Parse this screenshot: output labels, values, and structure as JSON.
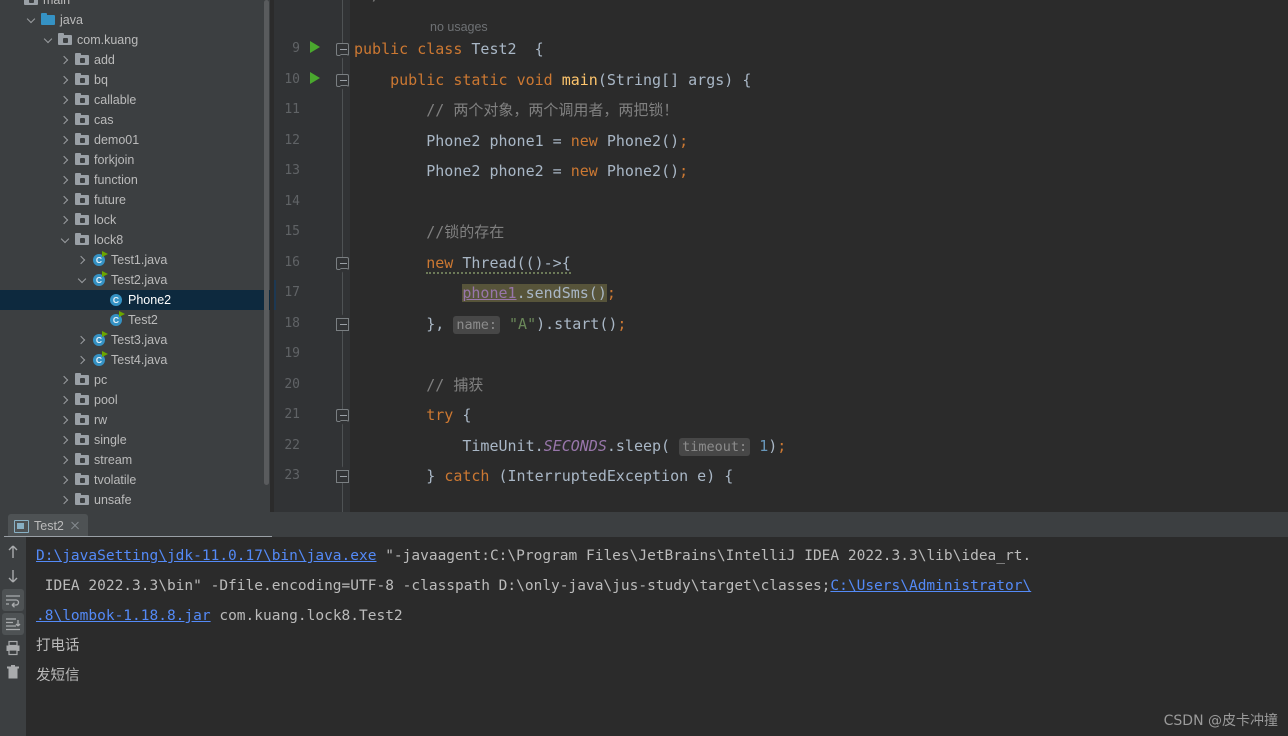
{
  "ide": {
    "theme_bg": "#2b2b2b",
    "panel_bg": "#3c3f41",
    "accent_blue": "#3592c4",
    "selection_blue": "#0d293e",
    "link_blue": "#548af7",
    "keyword_orange": "#cc7832",
    "string_green": "#6a8759",
    "field_purple": "#9876aa",
    "number_blue": "#6897bb",
    "comment_grey": "#808080",
    "run_green": "#4aa82e"
  },
  "project_tree": {
    "name": "project-tree",
    "rows": [
      {
        "label": "main",
        "indent": 0,
        "arrow": "none",
        "icon": "folder-package-icon",
        "partial": true
      },
      {
        "label": "java",
        "indent": 1,
        "arrow": "down",
        "icon": "source-root-folder-icon"
      },
      {
        "label": "com.kuang",
        "indent": 2,
        "arrow": "down",
        "icon": "folder-package-icon"
      },
      {
        "label": "add",
        "indent": 3,
        "arrow": "right",
        "icon": "folder-package-icon"
      },
      {
        "label": "bq",
        "indent": 3,
        "arrow": "right",
        "icon": "folder-package-icon"
      },
      {
        "label": "callable",
        "indent": 3,
        "arrow": "right",
        "icon": "folder-package-icon"
      },
      {
        "label": "cas",
        "indent": 3,
        "arrow": "right",
        "icon": "folder-package-icon"
      },
      {
        "label": "demo01",
        "indent": 3,
        "arrow": "right",
        "icon": "folder-package-icon"
      },
      {
        "label": "forkjoin",
        "indent": 3,
        "arrow": "right",
        "icon": "folder-package-icon"
      },
      {
        "label": "function",
        "indent": 3,
        "arrow": "right",
        "icon": "folder-package-icon"
      },
      {
        "label": "future",
        "indent": 3,
        "arrow": "right",
        "icon": "folder-package-icon"
      },
      {
        "label": "lock",
        "indent": 3,
        "arrow": "right",
        "icon": "folder-package-icon"
      },
      {
        "label": "lock8",
        "indent": 3,
        "arrow": "down",
        "icon": "folder-package-icon"
      },
      {
        "label": "Test1.java",
        "indent": 4,
        "arrow": "right",
        "icon": "java-class-runnable-icon"
      },
      {
        "label": "Test2.java",
        "indent": 4,
        "arrow": "down",
        "icon": "java-class-runnable-icon"
      },
      {
        "label": "Phone2",
        "indent": 5,
        "arrow": "none",
        "icon": "java-class-icon",
        "selected": true
      },
      {
        "label": "Test2",
        "indent": 5,
        "arrow": "none",
        "icon": "java-class-runnable-icon"
      },
      {
        "label": "Test3.java",
        "indent": 4,
        "arrow": "right",
        "icon": "java-class-runnable-icon"
      },
      {
        "label": "Test4.java",
        "indent": 4,
        "arrow": "right",
        "icon": "java-class-runnable-icon"
      },
      {
        "label": "pc",
        "indent": 3,
        "arrow": "right",
        "icon": "folder-package-icon"
      },
      {
        "label": "pool",
        "indent": 3,
        "arrow": "right",
        "icon": "folder-package-icon"
      },
      {
        "label": "rw",
        "indent": 3,
        "arrow": "right",
        "icon": "folder-package-icon"
      },
      {
        "label": "single",
        "indent": 3,
        "arrow": "right",
        "icon": "folder-package-icon"
      },
      {
        "label": "stream",
        "indent": 3,
        "arrow": "right",
        "icon": "folder-package-icon"
      },
      {
        "label": "tvolatile",
        "indent": 3,
        "arrow": "right",
        "icon": "folder-package-icon"
      },
      {
        "label": "unsafe",
        "indent": 3,
        "arrow": "right",
        "icon": "folder-package-icon"
      }
    ]
  },
  "editor": {
    "inlay_no_usages": "no usages",
    "first_line_number": 9,
    "last_line_number": 23,
    "line_numbers": [
      9,
      10,
      11,
      12,
      13,
      14,
      15,
      16,
      17,
      18,
      19,
      20,
      21,
      22,
      23
    ],
    "run_gutter_lines": [
      9,
      10
    ],
    "lines": [
      {
        "n": 9,
        "text": "public class Test2  {"
      },
      {
        "n": 10,
        "text": "    public static void main(String[] args) {"
      },
      {
        "n": 11,
        "text": "        // 两个对象，两个调用者，两把锁！"
      },
      {
        "n": 12,
        "text": "        Phone2 phone1 = new Phone2();"
      },
      {
        "n": 13,
        "text": "        Phone2 phone2 = new Phone2();"
      },
      {
        "n": 14,
        "text": ""
      },
      {
        "n": 15,
        "text": "        //锁的存在"
      },
      {
        "n": 16,
        "text": "        new Thread(()->{"
      },
      {
        "n": 17,
        "text": "            phone1.sendSms();"
      },
      {
        "n": 18,
        "text": "        }, name: \"A\").start();"
      },
      {
        "n": 19,
        "text": ""
      },
      {
        "n": 20,
        "text": "        // 捕获"
      },
      {
        "n": 21,
        "text": "        try {"
      },
      {
        "n": 22,
        "text": "            TimeUnit.SECONDS.sleep( timeout: 1);"
      },
      {
        "n": 23,
        "text": "        } catch (InterruptedException e) {"
      }
    ],
    "tokens": {
      "kw_public": "public",
      "kw_class": "class",
      "kw_static": "static",
      "kw_void": "void",
      "kw_new": "new",
      "kw_try": "try",
      "kw_catch": "catch",
      "type_Test2": "Test2",
      "type_Phone2": "Phone2",
      "type_String": "String[]",
      "type_Thread": "Thread",
      "type_TimeUnit": "TimeUnit",
      "type_InterruptedException": "InterruptedException",
      "id_main": "main",
      "id_args": "args",
      "id_phone1": "phone1",
      "id_phone2": "phone2",
      "id_sendSms": "sendSms",
      "id_start": "start",
      "id_sleep": "sleep",
      "id_e": "e",
      "const_SECONDS": "SECONDS",
      "hint_name": "name:",
      "hint_timeout": "timeout:",
      "str_A": "\"A\"",
      "num_1": "1",
      "comment_11": "// 两个对象，两个调用者，两把锁！",
      "comment_15": "//锁的存在",
      "comment_20": "// 捕获"
    }
  },
  "run_panel": {
    "tab": {
      "label": "Test2",
      "icon": "console-icon",
      "close_icon": "close-icon"
    },
    "toolbar": [
      {
        "name": "up-arrow-icon",
        "title": "Up",
        "active": false
      },
      {
        "name": "down-arrow-icon",
        "title": "Down",
        "active": false
      },
      {
        "name": "soft-wrap-icon",
        "title": "Soft-Wrap",
        "active": true
      },
      {
        "name": "scroll-to-end-icon",
        "title": "Scroll to End",
        "active": true
      },
      {
        "name": "print-icon",
        "title": "Print",
        "active": false
      },
      {
        "name": "trash-icon",
        "title": "Clear All",
        "active": false
      }
    ],
    "console_lines": [
      {
        "segments": [
          {
            "text": "D:\\javaSetting\\jdk-11.0.17\\bin\\java.exe",
            "style": "link"
          },
          {
            "text": " \"-javaagent:C:\\Program Files\\JetBrains\\IntelliJ IDEA 2022.3.3\\lib\\idea_rt.",
            "style": "out"
          }
        ]
      },
      {
        "segments": [
          {
            "text": " IDEA 2022.3.3\\bin\" -Dfile.encoding=UTF-8 -classpath D:\\only-java\\jus-study\\target\\classes;",
            "style": "out"
          },
          {
            "text": "C:\\Users\\Administrator\\",
            "style": "link"
          }
        ]
      },
      {
        "segments": [
          {
            "text": ".8\\lombok-1.18.8.jar",
            "style": "link"
          },
          {
            "text": " com.kuang.lock8.Test2",
            "style": "out"
          }
        ]
      },
      {
        "segments": [
          {
            "text": "打电话",
            "style": "cn"
          }
        ]
      },
      {
        "segments": [
          {
            "text": "发短信",
            "style": "cn"
          }
        ]
      }
    ]
  },
  "watermark": {
    "text": "CSDN @皮卡冲撞"
  }
}
